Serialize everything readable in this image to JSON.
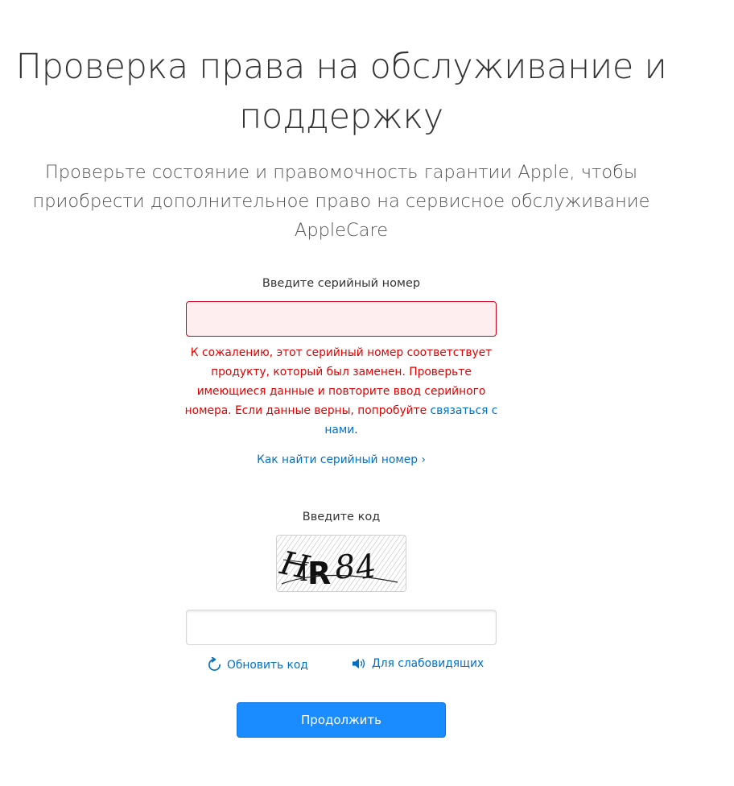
{
  "hero": {
    "title_line1": "Проверка права на обслуживание и",
    "title_line2": "поддержку",
    "subtitle": "Проверьте состояние и правомочность гарантии Apple, чтобы приобрести дополнительное право на сервисное обслуживание AppleCare"
  },
  "serial": {
    "label": "Введите серийный номер",
    "value": "",
    "placeholder": "",
    "error_text": "К сожалению, этот серийный номер соответствует продукту, который был заменен. Проверьте имеющиеся данные и повторите ввод серийного номера. Если данные верны, попробуйте ",
    "error_link": "связаться с нами",
    "error_end": ".",
    "howto_link": "Как найти серийный номер ›"
  },
  "captcha": {
    "label": "Введите код",
    "image_text": "HIR84",
    "value": "",
    "refresh_label": "Обновить код",
    "audio_label": "Для слабовидящих"
  },
  "submit": {
    "label": "Продолжить"
  },
  "colors": {
    "error": "#e30000",
    "link": "#0070c9",
    "button": "#1a8cff",
    "error_field_bg": "#feeeef",
    "error_field_border": "#d0021b"
  },
  "icons": {
    "refresh": "refresh-icon",
    "audio": "speaker-icon"
  }
}
